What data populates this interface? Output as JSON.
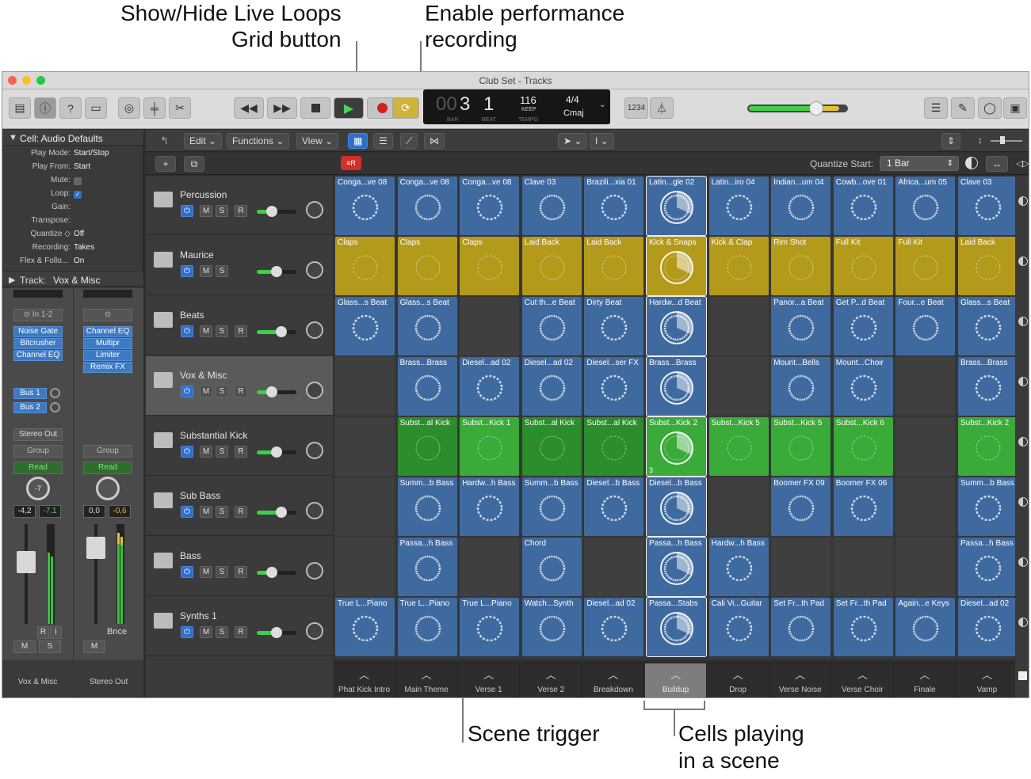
{
  "callouts": {
    "live_loops_l1": "Show/Hide Live Loops",
    "live_loops_l2": "Grid button",
    "perf_l1": "Enable performance",
    "perf_l2": "recording",
    "scene_trigger": "Scene trigger",
    "cells_l1": "Cells playing",
    "cells_l2": "in a scene"
  },
  "window": {
    "title": "Club Set - Tracks"
  },
  "lcd": {
    "bar": "3",
    "bar_prefix": "00",
    "beat": "1",
    "bar_label": "BAR",
    "beat_label": "BEAT",
    "tempo": "116",
    "keep": "KEEP",
    "tempo_label": "TEMPO",
    "sig": "4/4",
    "key": "Cmaj"
  },
  "toolbar": {
    "count_in": "1234"
  },
  "inspector": {
    "cell_header": "Cell: Audio Defaults",
    "rows": [
      {
        "k": "Play Mode:",
        "v": "Start/Stop"
      },
      {
        "k": "Play From:",
        "v": "Start"
      },
      {
        "k": "Mute:",
        "v": ""
      },
      {
        "k": "Loop:",
        "v": "✓"
      },
      {
        "k": "Gain:",
        "v": ""
      },
      {
        "k": "Transpose:",
        "v": ""
      },
      {
        "k": "Quantize ◇",
        "v": "Off"
      },
      {
        "k": "Recording:",
        "v": "Takes"
      },
      {
        "k": "Flex & Follo...",
        "v": "On"
      }
    ],
    "track_label": "Track:",
    "track_name": "Vox & Misc",
    "io": "In 1-2",
    "plugins_left": [
      "Noise Gate",
      "Bitcrusher",
      "Channel EQ"
    ],
    "plugins_right": [
      "Channel EQ",
      "Multipr",
      "Limiter",
      "Remix FX"
    ],
    "sends": [
      "Bus 1",
      "Bus 2"
    ],
    "output": "Stereo Out",
    "group": "Group",
    "auto": "Read",
    "left_vals": [
      "-4,2",
      "-7,1"
    ],
    "right_vals": [
      "0,0",
      "-0,6"
    ],
    "knob_val": "-7",
    "ri": [
      "R",
      "I"
    ],
    "bnce": "Bnce",
    "ms_left": [
      "M",
      "S"
    ],
    "m_right": "M",
    "strip_left": "Vox & Misc",
    "strip_right": "Stereo Out",
    "scale": [
      "0",
      "3",
      "6",
      "10",
      "15",
      "20",
      "25",
      "30",
      "35",
      "40",
      "50",
      "60"
    ]
  },
  "menu": {
    "edit": "Edit",
    "functions": "Functions",
    "view": "View"
  },
  "quantize": {
    "label": "Quantize Start:",
    "value": "1 Bar"
  },
  "tracks": [
    {
      "name": "Percussion",
      "r": true
    },
    {
      "name": "Maurice",
      "r": false
    },
    {
      "name": "Beats",
      "r": true
    },
    {
      "name": "Vox & Misc",
      "r": true
    },
    {
      "name": "Substantial Kick",
      "r": true
    },
    {
      "name": "Sub Bass",
      "r": true
    },
    {
      "name": "Bass",
      "r": true
    },
    {
      "name": "Synths 1",
      "r": true
    }
  ],
  "track_btns": {
    "m": "M",
    "s": "S",
    "r": "R"
  },
  "grid": [
    [
      [
        "Conga...ve 08",
        "blue"
      ],
      [
        "Conga...ve 08",
        "blue"
      ],
      [
        "Conga...ve 08",
        "blue"
      ],
      [
        "Clave 03",
        "blue"
      ],
      [
        "Brazili...xia 01",
        "blue"
      ],
      [
        "Latin...gle 02",
        "blue",
        "play"
      ],
      [
        "Latin...iro 04",
        "blue"
      ],
      [
        "Indian...um 04",
        "blue"
      ],
      [
        "Cowb...ove 01",
        "blue"
      ],
      [
        "Africa...um 05",
        "blue"
      ],
      [
        "Clave 03",
        "blue"
      ]
    ],
    [
      [
        "Claps",
        "yel"
      ],
      [
        "Claps",
        "yel"
      ],
      [
        "Claps",
        "yel"
      ],
      [
        "Laid Back",
        "yel"
      ],
      [
        "Laid Back",
        "yel"
      ],
      [
        "Kick & Snaps",
        "yel",
        "play"
      ],
      [
        "Kick & Clap",
        "yel"
      ],
      [
        "Rim Shot",
        "yel"
      ],
      [
        "Full Kit",
        "yel"
      ],
      [
        "Full Kit",
        "yel"
      ],
      [
        "Laid Back",
        "yel"
      ]
    ],
    [
      [
        "Glass...s Beat",
        "blue"
      ],
      [
        "Glass...s Beat",
        "blue"
      ],
      null,
      [
        "Cut th...e Beat",
        "blue"
      ],
      [
        "Dirty Beat",
        "blue"
      ],
      [
        "Hardw...d Beat",
        "blue",
        "play"
      ],
      null,
      [
        "Panor...a Beat",
        "blue"
      ],
      [
        "Get P...d Beat",
        "blue"
      ],
      [
        "Four...e Beat",
        "blue"
      ],
      [
        "Glass...s Beat",
        "blue"
      ]
    ],
    [
      null,
      [
        "Brass...Brass",
        "blue"
      ],
      [
        "Diesel...ad 02",
        "blue"
      ],
      [
        "Diesel...ad 02",
        "blue"
      ],
      [
        "Diesel...ser FX",
        "blue"
      ],
      [
        "Brass...Brass",
        "blue",
        "play"
      ],
      null,
      [
        "Mount...Bells",
        "blue"
      ],
      [
        "Mount...Choir",
        "blue"
      ],
      null,
      [
        "Brass...Brass",
        "blue"
      ]
    ],
    [
      null,
      [
        "Subst...al Kick",
        "dgrn"
      ],
      [
        "Subst...Kick 1",
        "grn"
      ],
      [
        "Subst...al Kick",
        "dgrn"
      ],
      [
        "Subst...al Kick",
        "dgrn"
      ],
      [
        "Subst...Kick 2",
        "grn",
        "play"
      ],
      [
        "Subst...Kick 5",
        "grn"
      ],
      [
        "Subst...Kick 5",
        "grn"
      ],
      [
        "Subst...Kick 6",
        "grn"
      ],
      null,
      [
        "Subst...Kick 2",
        "grn"
      ]
    ],
    [
      null,
      [
        "Summ...b Bass",
        "blue"
      ],
      [
        "Hardw...h Bass",
        "blue"
      ],
      [
        "Summ...b Bass",
        "blue"
      ],
      [
        "Diesel...b Bass",
        "blue"
      ],
      [
        "Diesel...b Bass",
        "blue",
        "play"
      ],
      null,
      [
        "Boomer FX 09",
        "blue"
      ],
      [
        "Boomer FX 06",
        "blue"
      ],
      null,
      [
        "Summ...b Bass",
        "blue"
      ]
    ],
    [
      null,
      [
        "Passa...h Bass",
        "blue"
      ],
      null,
      [
        "Chord",
        "blue"
      ],
      null,
      [
        "Passa...h Bass",
        "blue",
        "play"
      ],
      [
        "Hardw...h Bass",
        "blue"
      ],
      null,
      null,
      null,
      [
        "Passa...h Bass",
        "blue"
      ]
    ],
    [
      [
        "True L...Piano",
        "blue"
      ],
      [
        "True L...Piano",
        "blue"
      ],
      [
        "True L...Piano",
        "blue"
      ],
      [
        "Watch...Synth",
        "blue"
      ],
      [
        "Diesel...ad 02",
        "blue"
      ],
      [
        "Passa...Stabs",
        "blue",
        "play"
      ],
      [
        "Cali Vi...Guitar",
        "blue"
      ],
      [
        "Set Fr...th Pad",
        "blue"
      ],
      [
        "Set Fr...th Pad",
        "blue"
      ],
      [
        "Again...e Keys",
        "blue"
      ],
      [
        "Diesel...ad 02",
        "blue"
      ]
    ]
  ],
  "cell_number": "3",
  "scenes": [
    "Phat Kick Intro",
    "Main Theme",
    "Verse 1",
    "Verse 2",
    "Breakdown",
    "Buildup",
    "Drop",
    "Verse Noise",
    "Verse Choir",
    "Finale",
    "Vamp"
  ],
  "active_scene": 5,
  "colors": {
    "blue": "#3f6aa0",
    "yellow": "#b49a1b",
    "green": "#3aaa38",
    "accent": "#2f6fc9",
    "record": "#d0211d"
  }
}
